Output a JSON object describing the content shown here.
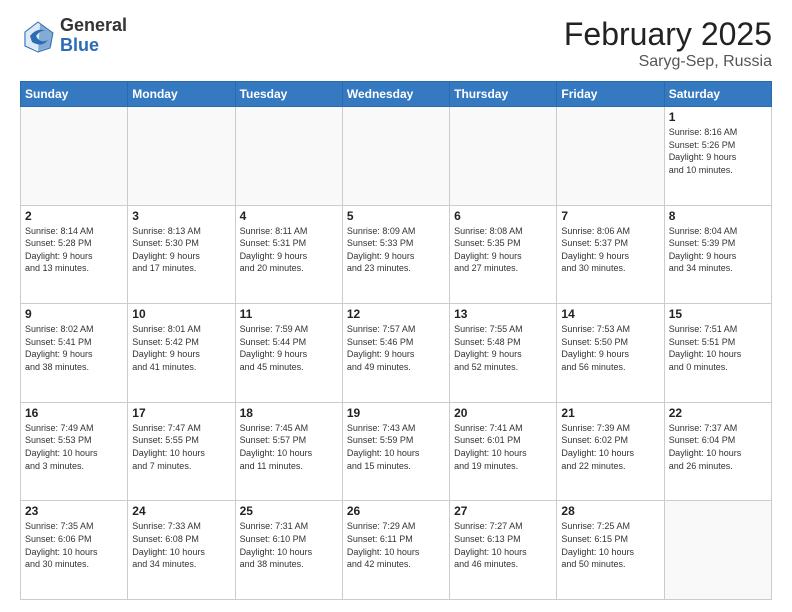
{
  "header": {
    "logo_general": "General",
    "logo_blue": "Blue",
    "month_year": "February 2025",
    "location": "Saryg-Sep, Russia"
  },
  "days_of_week": [
    "Sunday",
    "Monday",
    "Tuesday",
    "Wednesday",
    "Thursday",
    "Friday",
    "Saturday"
  ],
  "weeks": [
    [
      {
        "day": "",
        "info": ""
      },
      {
        "day": "",
        "info": ""
      },
      {
        "day": "",
        "info": ""
      },
      {
        "day": "",
        "info": ""
      },
      {
        "day": "",
        "info": ""
      },
      {
        "day": "",
        "info": ""
      },
      {
        "day": "1",
        "info": "Sunrise: 8:16 AM\nSunset: 5:26 PM\nDaylight: 9 hours\nand 10 minutes."
      }
    ],
    [
      {
        "day": "2",
        "info": "Sunrise: 8:14 AM\nSunset: 5:28 PM\nDaylight: 9 hours\nand 13 minutes."
      },
      {
        "day": "3",
        "info": "Sunrise: 8:13 AM\nSunset: 5:30 PM\nDaylight: 9 hours\nand 17 minutes."
      },
      {
        "day": "4",
        "info": "Sunrise: 8:11 AM\nSunset: 5:31 PM\nDaylight: 9 hours\nand 20 minutes."
      },
      {
        "day": "5",
        "info": "Sunrise: 8:09 AM\nSunset: 5:33 PM\nDaylight: 9 hours\nand 23 minutes."
      },
      {
        "day": "6",
        "info": "Sunrise: 8:08 AM\nSunset: 5:35 PM\nDaylight: 9 hours\nand 27 minutes."
      },
      {
        "day": "7",
        "info": "Sunrise: 8:06 AM\nSunset: 5:37 PM\nDaylight: 9 hours\nand 30 minutes."
      },
      {
        "day": "8",
        "info": "Sunrise: 8:04 AM\nSunset: 5:39 PM\nDaylight: 9 hours\nand 34 minutes."
      }
    ],
    [
      {
        "day": "9",
        "info": "Sunrise: 8:02 AM\nSunset: 5:41 PM\nDaylight: 9 hours\nand 38 minutes."
      },
      {
        "day": "10",
        "info": "Sunrise: 8:01 AM\nSunset: 5:42 PM\nDaylight: 9 hours\nand 41 minutes."
      },
      {
        "day": "11",
        "info": "Sunrise: 7:59 AM\nSunset: 5:44 PM\nDaylight: 9 hours\nand 45 minutes."
      },
      {
        "day": "12",
        "info": "Sunrise: 7:57 AM\nSunset: 5:46 PM\nDaylight: 9 hours\nand 49 minutes."
      },
      {
        "day": "13",
        "info": "Sunrise: 7:55 AM\nSunset: 5:48 PM\nDaylight: 9 hours\nand 52 minutes."
      },
      {
        "day": "14",
        "info": "Sunrise: 7:53 AM\nSunset: 5:50 PM\nDaylight: 9 hours\nand 56 minutes."
      },
      {
        "day": "15",
        "info": "Sunrise: 7:51 AM\nSunset: 5:51 PM\nDaylight: 10 hours\nand 0 minutes."
      }
    ],
    [
      {
        "day": "16",
        "info": "Sunrise: 7:49 AM\nSunset: 5:53 PM\nDaylight: 10 hours\nand 3 minutes."
      },
      {
        "day": "17",
        "info": "Sunrise: 7:47 AM\nSunset: 5:55 PM\nDaylight: 10 hours\nand 7 minutes."
      },
      {
        "day": "18",
        "info": "Sunrise: 7:45 AM\nSunset: 5:57 PM\nDaylight: 10 hours\nand 11 minutes."
      },
      {
        "day": "19",
        "info": "Sunrise: 7:43 AM\nSunset: 5:59 PM\nDaylight: 10 hours\nand 15 minutes."
      },
      {
        "day": "20",
        "info": "Sunrise: 7:41 AM\nSunset: 6:01 PM\nDaylight: 10 hours\nand 19 minutes."
      },
      {
        "day": "21",
        "info": "Sunrise: 7:39 AM\nSunset: 6:02 PM\nDaylight: 10 hours\nand 22 minutes."
      },
      {
        "day": "22",
        "info": "Sunrise: 7:37 AM\nSunset: 6:04 PM\nDaylight: 10 hours\nand 26 minutes."
      }
    ],
    [
      {
        "day": "23",
        "info": "Sunrise: 7:35 AM\nSunset: 6:06 PM\nDaylight: 10 hours\nand 30 minutes."
      },
      {
        "day": "24",
        "info": "Sunrise: 7:33 AM\nSunset: 6:08 PM\nDaylight: 10 hours\nand 34 minutes."
      },
      {
        "day": "25",
        "info": "Sunrise: 7:31 AM\nSunset: 6:10 PM\nDaylight: 10 hours\nand 38 minutes."
      },
      {
        "day": "26",
        "info": "Sunrise: 7:29 AM\nSunset: 6:11 PM\nDaylight: 10 hours\nand 42 minutes."
      },
      {
        "day": "27",
        "info": "Sunrise: 7:27 AM\nSunset: 6:13 PM\nDaylight: 10 hours\nand 46 minutes."
      },
      {
        "day": "28",
        "info": "Sunrise: 7:25 AM\nSunset: 6:15 PM\nDaylight: 10 hours\nand 50 minutes."
      },
      {
        "day": "",
        "info": ""
      }
    ]
  ]
}
